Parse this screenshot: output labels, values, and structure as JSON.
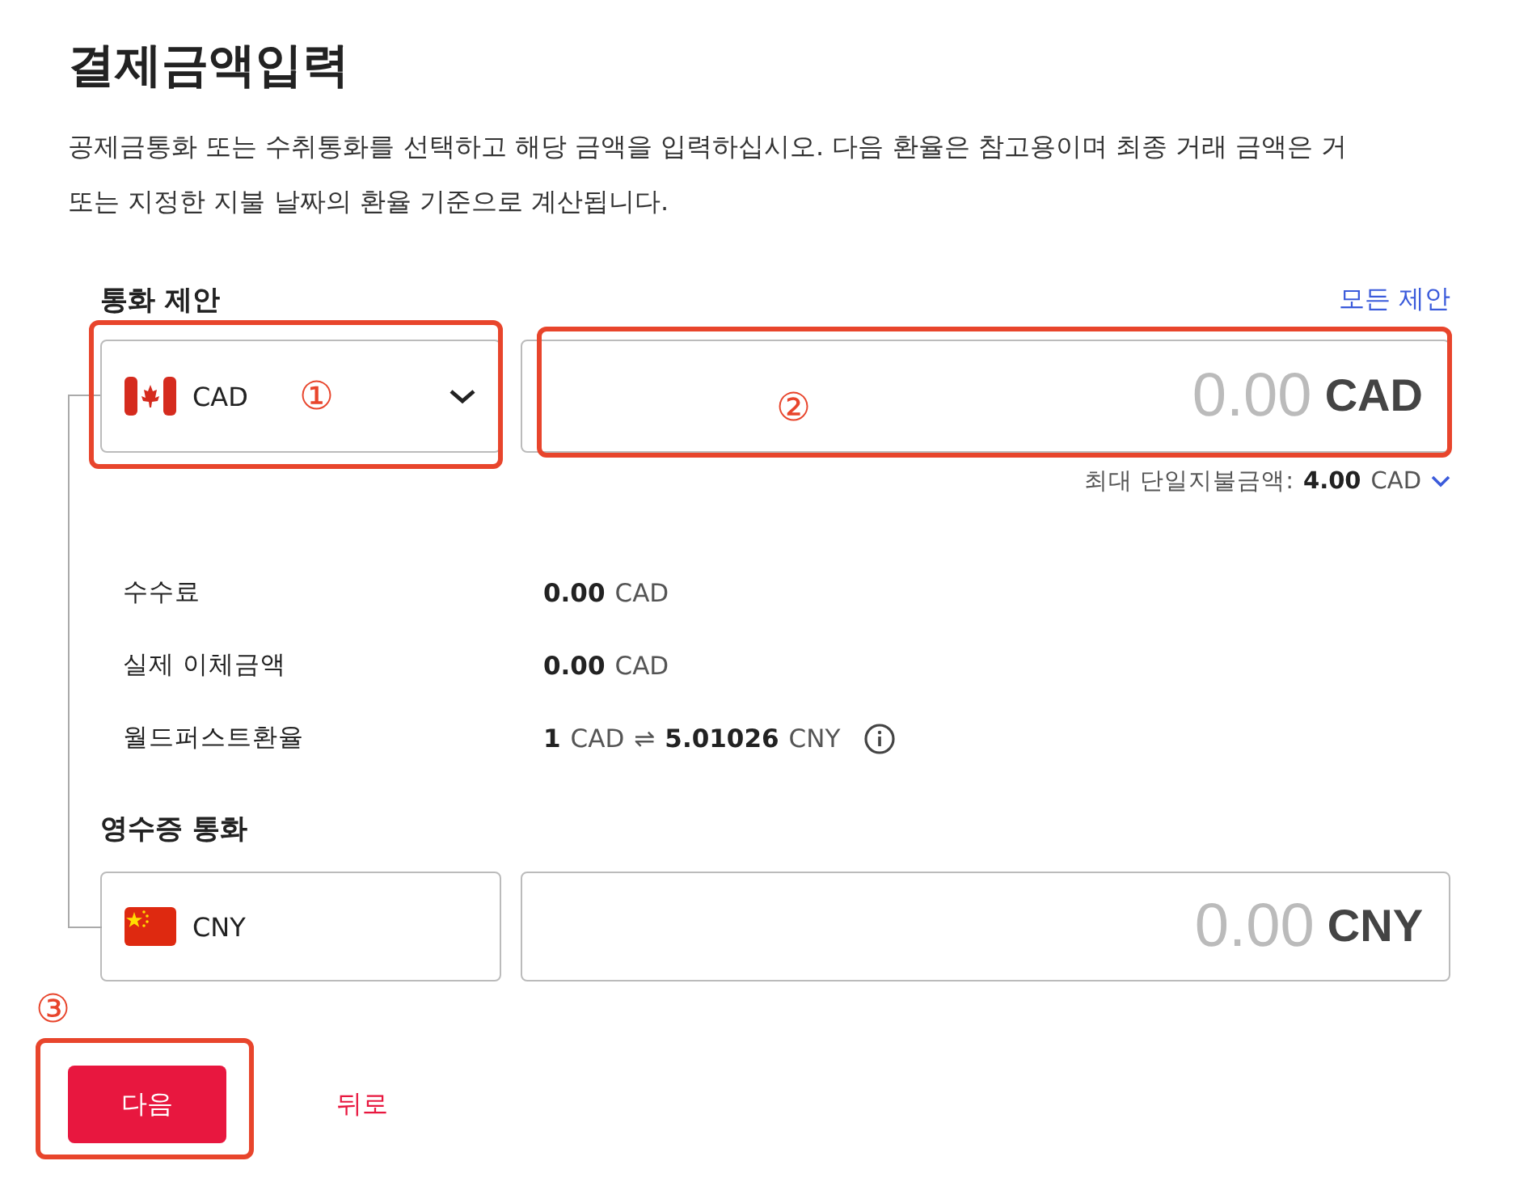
{
  "title": "결제금액입력",
  "description": "공제금통화 또는 수취통화를 선택하고 해당 금액을 입력하십시오. 다음 환율은 참고용이며 최종 거래 금액은 거\n또는 지정한 지불 날짜의 환율 기준으로 계산됩니다.",
  "send": {
    "label": "통화 제안",
    "link": "모든 제안",
    "currency": "CAD",
    "amount_placeholder": "0.00",
    "amount_currency": "CAD",
    "limit_label": "최대 단일지불금액:",
    "limit_value": "4.00",
    "limit_currency": "CAD"
  },
  "details": [
    {
      "label": "수수료",
      "info": false,
      "parts": [
        {
          "text": "0.00",
          "bold": true
        },
        {
          "text": "CAD",
          "bold": false
        }
      ]
    },
    {
      "label": "실제 이체금액",
      "info": false,
      "parts": [
        {
          "text": "0.00",
          "bold": true
        },
        {
          "text": "CAD",
          "bold": false
        }
      ]
    },
    {
      "label": "월드퍼스트환율",
      "info": true,
      "parts": [
        {
          "text": "1",
          "bold": true
        },
        {
          "text": "CAD",
          "bold": false
        },
        {
          "text": "⇌",
          "bold": false
        },
        {
          "text": "5.01026",
          "bold": true
        },
        {
          "text": "CNY",
          "bold": false
        }
      ]
    }
  ],
  "receive": {
    "label": "영수증 통화",
    "currency": "CNY",
    "amount_placeholder": "0.00",
    "amount_currency": "CNY"
  },
  "buttons": [
    {
      "label": "다음",
      "kind": "primary"
    },
    {
      "label": "뒤로",
      "kind": "link"
    }
  ],
  "annotations": [
    {
      "label": "①"
    },
    {
      "label": "②"
    },
    {
      "label": "③"
    }
  ]
}
